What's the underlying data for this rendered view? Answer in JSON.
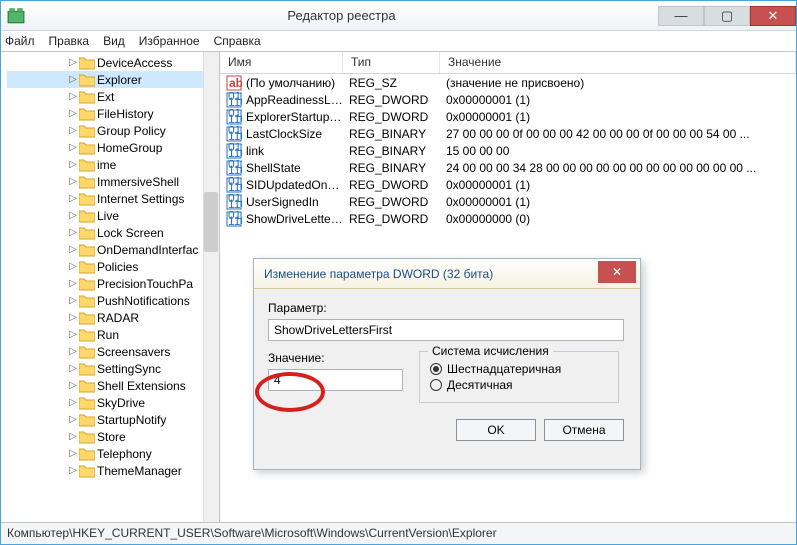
{
  "window": {
    "title": "Редактор реестра"
  },
  "menu": {
    "file": "Файл",
    "edit": "Правка",
    "view": "Вид",
    "favorites": "Избранное",
    "help": "Справка"
  },
  "tree": {
    "items": [
      "DeviceAccess",
      "Explorer",
      "Ext",
      "FileHistory",
      "Group Policy",
      "HomeGroup",
      "ime",
      "ImmersiveShell",
      "Internet Settings",
      "Live",
      "Lock Screen",
      "OnDemandInterfac",
      "Policies",
      "PrecisionTouchPa",
      "PushNotifications",
      "RADAR",
      "Run",
      "Screensavers",
      "SettingSync",
      "Shell Extensions",
      "SkyDrive",
      "StartupNotify",
      "Store",
      "Telephony",
      "ThemeManager"
    ],
    "selected_index": 1
  },
  "columns": {
    "name": "Имя",
    "type": "Тип",
    "value": "Значение"
  },
  "list": [
    {
      "icon": "str",
      "name": "(По умолчанию)",
      "type": "REG_SZ",
      "value": "(значение не присвоено)"
    },
    {
      "icon": "bin",
      "name": "AppReadinessLo...",
      "type": "REG_DWORD",
      "value": "0x00000001 (1)"
    },
    {
      "icon": "bin",
      "name": "ExplorerStartupT...",
      "type": "REG_DWORD",
      "value": "0x00000001 (1)"
    },
    {
      "icon": "bin",
      "name": "LastClockSize",
      "type": "REG_BINARY",
      "value": "27 00 00 00 0f 00 00 00 42 00 00 00 0f 00 00 00 54 00 ..."
    },
    {
      "icon": "bin",
      "name": "link",
      "type": "REG_BINARY",
      "value": "15 00 00 00"
    },
    {
      "icon": "bin",
      "name": "ShellState",
      "type": "REG_BINARY",
      "value": "24 00 00 00 34 28 00 00 00 00 00 00 00 00 00 00 00 00 ..."
    },
    {
      "icon": "bin",
      "name": "SIDUpdatedOnLi...",
      "type": "REG_DWORD",
      "value": "0x00000001 (1)"
    },
    {
      "icon": "bin",
      "name": "UserSignedIn",
      "type": "REG_DWORD",
      "value": "0x00000001 (1)"
    },
    {
      "icon": "bin",
      "name": "ShowDriveLetter...",
      "type": "REG_DWORD",
      "value": "0x00000000 (0)"
    }
  ],
  "dialog": {
    "title": "Изменение параметра DWORD (32 бита)",
    "param_label": "Параметр:",
    "param_value": "ShowDriveLettersFirst",
    "value_label": "Значение:",
    "value_value": "4",
    "group_title": "Система исчисления",
    "radio_hex": "Шестнадцатеричная",
    "radio_dec": "Десятичная",
    "ok": "OK",
    "cancel": "Отмена"
  },
  "status": "Компьютер\\HKEY_CURRENT_USER\\Software\\Microsoft\\Windows\\CurrentVersion\\Explorer"
}
